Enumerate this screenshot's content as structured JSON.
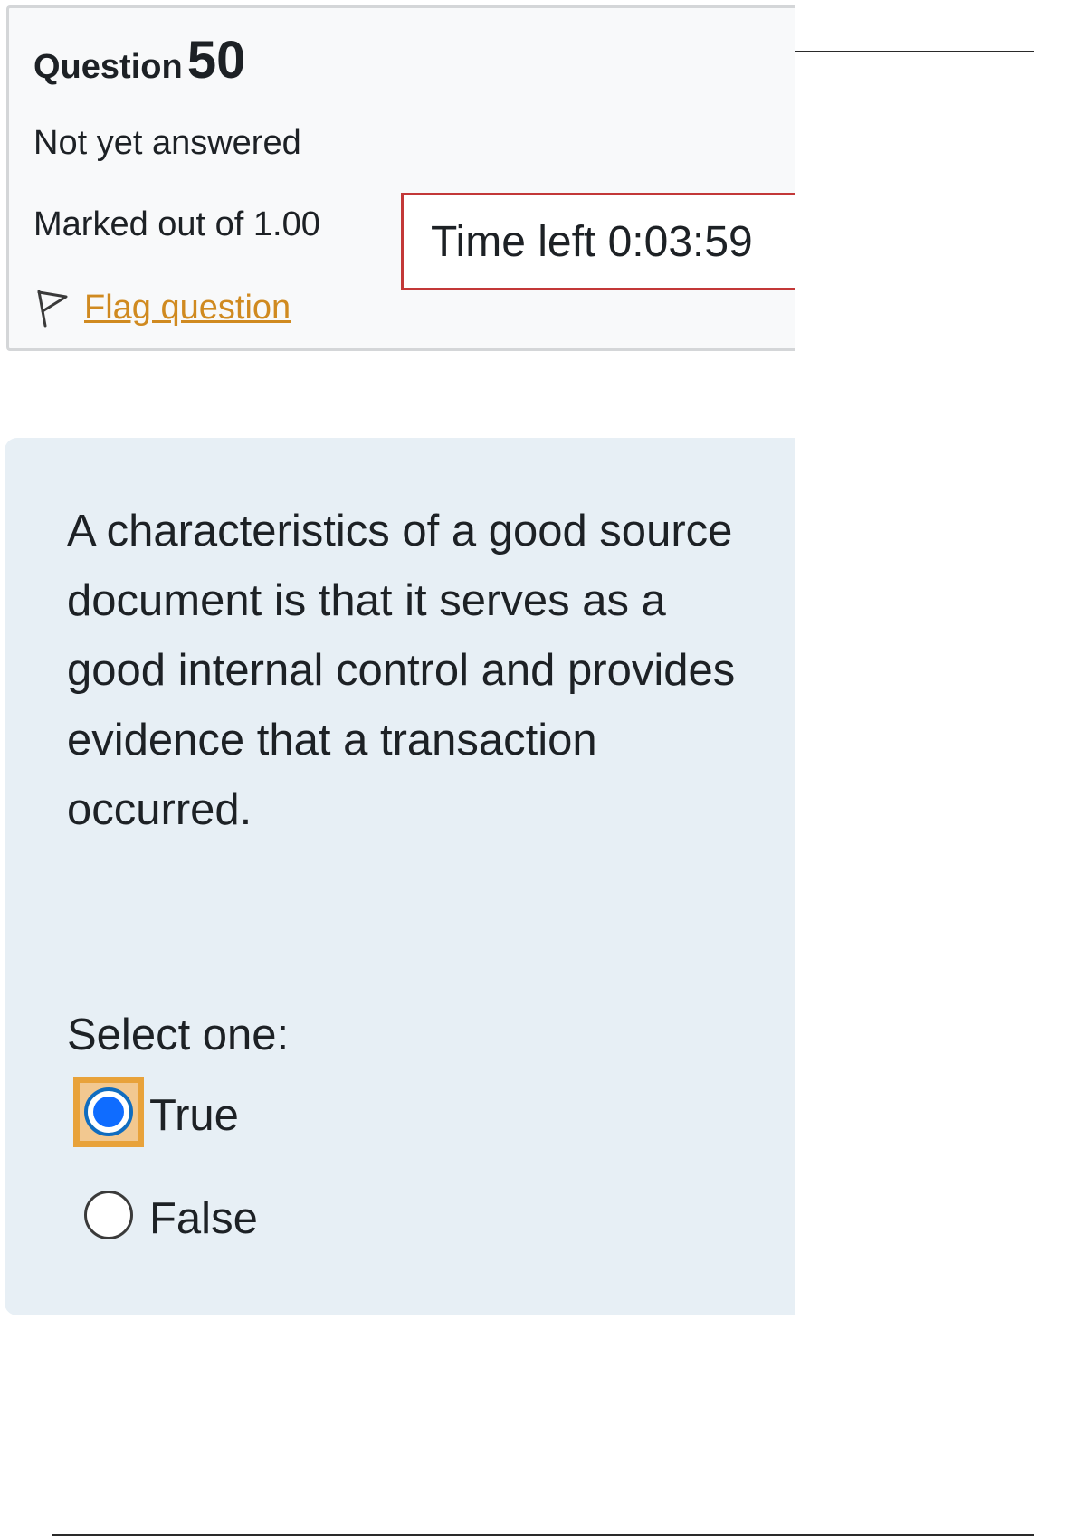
{
  "question_info": {
    "question_word": "Question",
    "question_number": "50",
    "state": "Not yet answered",
    "grade": "Marked out of 1.00",
    "flag_label": "Flag question",
    "flag_icon": "flag-outline-icon",
    "link_color": "#d08a20"
  },
  "timer": {
    "label": "Time left",
    "value": "0:03:59",
    "border_color": "#c33838"
  },
  "question": {
    "text": "A characteristics of a good source document is that it serves as a good internal control and provides evidence that a transaction occurred.",
    "prompt": "Select one:",
    "options": [
      {
        "label": "True",
        "selected": true,
        "focused": true
      },
      {
        "label": "False",
        "selected": false,
        "focused": false
      }
    ],
    "background": "#e7eff5",
    "selected_color": "#0f6cff",
    "focus_color": "#e8a23a"
  }
}
